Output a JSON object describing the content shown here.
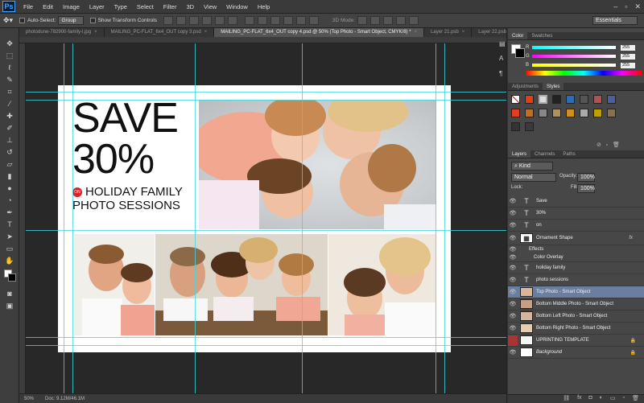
{
  "menubar": {
    "logo": "Ps",
    "items": [
      "File",
      "Edit",
      "Image",
      "Layer",
      "Type",
      "Select",
      "Filter",
      "3D",
      "View",
      "Window",
      "Help"
    ],
    "win_controls": [
      "–",
      "▫",
      "✕"
    ]
  },
  "options": {
    "auto_select_label": "Auto-Select:",
    "auto_select_value": "Group",
    "show_transform_label": "Show Transform Controls",
    "mode_3d_label": "3D Mode:",
    "workspace": "Essentials"
  },
  "tabs": [
    {
      "label": "photodune-782900-family-l.jpg"
    },
    {
      "label": "MAILING_PC-FLAT_6x4_OUT copy 3.psd"
    },
    {
      "label": "MAILING_PC-FLAT_6x4_OUT copy 4.psd @ 50% (Top Photo - Smart Object, CMYK/8) *",
      "active": true
    },
    {
      "label": "Layer 21.psb"
    },
    {
      "label": "Layer 22.psb"
    }
  ],
  "document": {
    "save": "SAVE",
    "percent": "30%",
    "on_badge": "ON",
    "holiday": "HOLIDAY FAMILY",
    "photo_sessions": "PHOTO SESSIONS",
    "accent_color": "#e21e26"
  },
  "status": {
    "zoom": "50%",
    "doc": "Doc: 9.12M/46.1M"
  },
  "color_panel": {
    "tabs": [
      "Color",
      "Swatches"
    ],
    "rows": [
      {
        "label": "R",
        "value": "255"
      },
      {
        "label": "G",
        "value": "255"
      },
      {
        "label": "B",
        "value": "255"
      }
    ]
  },
  "styles_panel": {
    "tabs": [
      "Adjustments",
      "Styles"
    ]
  },
  "layers_panel": {
    "tabs": [
      "Layers",
      "Channels",
      "Paths"
    ],
    "kind": "Kind",
    "blend_mode": "Normal",
    "opacity_label": "Opacity:",
    "opacity": "100%",
    "lock_label": "Lock:",
    "fill_label": "Fill:",
    "fill": "100%",
    "layers": [
      {
        "name": "Save",
        "kind": "text"
      },
      {
        "name": "30%",
        "kind": "text"
      },
      {
        "name": "on",
        "kind": "text"
      },
      {
        "name": "Ornament Shape",
        "kind": "shape",
        "fx": "fx"
      },
      {
        "name": "Effects",
        "kind": "effect-header"
      },
      {
        "name": "Color Overlay",
        "kind": "effect"
      },
      {
        "name": "holiday family",
        "kind": "text"
      },
      {
        "name": "photo sessions",
        "kind": "text"
      },
      {
        "name": "Top Photo - Smart Object",
        "kind": "smart",
        "selected": true
      },
      {
        "name": "Bottom Middle Photo - Smart Object",
        "kind": "smart"
      },
      {
        "name": "Bottom Left Photo - Smart Object",
        "kind": "smart"
      },
      {
        "name": "Bottom Right Photo - Smart Object",
        "kind": "smart"
      },
      {
        "name": "UPRINTING TEMPLATE",
        "kind": "template",
        "lock": "🔒"
      },
      {
        "name": "Background",
        "kind": "background",
        "lock": "🔒"
      }
    ]
  }
}
